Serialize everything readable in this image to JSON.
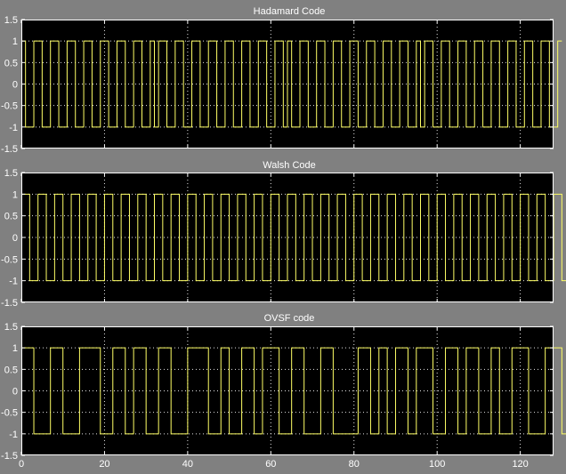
{
  "colors": {
    "figure_bg": "#808080",
    "axes_bg": "#000000",
    "signal": "#ffff66",
    "text": "#ffffff"
  },
  "chart_data": [
    {
      "type": "line",
      "title": "Hadamard Code",
      "xlim": [
        0,
        128
      ],
      "ylim": [
        -1.5,
        1.5
      ],
      "grid": true,
      "xticks": [
        0,
        20,
        40,
        60,
        80,
        100,
        120
      ],
      "xtick_labels_visible": false,
      "yticks": [
        -1.5,
        -1,
        -0.5,
        0,
        0.5,
        1,
        1.5
      ],
      "ytick_labels": [
        "-1.5",
        "-1",
        "-0.5",
        "0",
        "0.5",
        "1",
        "1.5"
      ],
      "series": [
        {
          "style": "step",
          "values": [
            1,
            -1,
            -1,
            1,
            1,
            -1,
            -1,
            1,
            1,
            -1,
            -1,
            1,
            1,
            -1,
            -1,
            1,
            1,
            -1,
            -1,
            1,
            1,
            -1,
            -1,
            1,
            1,
            -1,
            -1,
            1,
            1,
            -1,
            -1,
            1,
            -1,
            1,
            1,
            -1,
            -1,
            1,
            1,
            -1,
            -1,
            1,
            1,
            -1,
            -1,
            1,
            1,
            -1,
            -1,
            1,
            1,
            -1,
            -1,
            1,
            1,
            -1,
            -1,
            1,
            1,
            -1,
            -1,
            1,
            1,
            -1,
            1,
            -1,
            -1,
            1,
            1,
            -1,
            -1,
            1,
            1,
            -1,
            -1,
            1,
            1,
            -1,
            -1,
            1,
            1,
            -1,
            -1,
            1,
            1,
            -1,
            -1,
            1,
            1,
            -1,
            -1,
            1,
            1,
            -1,
            -1,
            1,
            -1,
            1,
            1,
            -1,
            -1,
            1,
            1,
            -1,
            -1,
            1,
            1,
            -1,
            -1,
            1,
            1,
            -1,
            -1,
            1,
            1,
            -1,
            -1,
            1,
            1,
            -1,
            -1,
            1,
            1,
            -1,
            -1,
            1,
            1,
            -1,
            -1,
            1
          ]
        }
      ]
    },
    {
      "type": "line",
      "title": "Walsh Code",
      "xlim": [
        0,
        128
      ],
      "ylim": [
        -1.5,
        1.5
      ],
      "grid": true,
      "xticks": [
        0,
        20,
        40,
        60,
        80,
        100,
        120
      ],
      "xtick_labels_visible": false,
      "yticks": [
        -1.5,
        -1,
        -0.5,
        0,
        0.5,
        1,
        1.5
      ],
      "ytick_labels": [
        "-1.5",
        "-1",
        "-0.5",
        "0",
        "0.5",
        "1",
        "1.5"
      ],
      "series": [
        {
          "style": "step",
          "values": [
            1,
            1,
            -1,
            -1,
            1,
            1,
            -1,
            -1,
            1,
            1,
            -1,
            -1,
            1,
            1,
            -1,
            -1,
            1,
            1,
            -1,
            -1,
            1,
            1,
            -1,
            -1,
            1,
            1,
            -1,
            -1,
            1,
            1,
            -1,
            -1,
            1,
            1,
            -1,
            -1,
            1,
            1,
            -1,
            -1,
            1,
            1,
            -1,
            -1,
            1,
            1,
            -1,
            -1,
            1,
            1,
            -1,
            -1,
            1,
            1,
            -1,
            -1,
            1,
            1,
            -1,
            -1,
            1,
            1,
            -1,
            -1,
            1,
            1,
            -1,
            -1,
            1,
            1,
            -1,
            -1,
            1,
            1,
            -1,
            -1,
            1,
            1,
            -1,
            -1,
            1,
            1,
            -1,
            -1,
            1,
            1,
            -1,
            -1,
            1,
            1,
            -1,
            -1,
            1,
            1,
            -1,
            -1,
            1,
            1,
            -1,
            -1,
            1,
            1,
            -1,
            -1,
            1,
            1,
            -1,
            -1,
            1,
            1,
            -1,
            -1,
            1,
            1,
            -1,
            -1,
            1,
            1,
            -1,
            -1,
            1,
            1,
            -1,
            -1,
            1,
            1,
            -1,
            -1,
            1,
            1,
            -1,
            -1
          ]
        }
      ]
    },
    {
      "type": "line",
      "title": "OVSF code",
      "xlim": [
        0,
        128
      ],
      "ylim": [
        -1.5,
        1.5
      ],
      "grid": true,
      "xticks": [
        0,
        20,
        40,
        60,
        80,
        100,
        120
      ],
      "xtick_labels": [
        "0",
        "20",
        "40",
        "60",
        "80",
        "100",
        "120"
      ],
      "yticks": [
        -1.5,
        -1,
        -0.5,
        0,
        0.5,
        1,
        1.5
      ],
      "ytick_labels": [
        "-1.5",
        "-1",
        "-0.5",
        "0",
        "0.5",
        "1",
        "1.5"
      ],
      "series": [
        {
          "style": "step",
          "values": [
            1,
            1,
            1,
            -1,
            -1,
            -1,
            -1,
            1,
            1,
            1,
            -1,
            -1,
            -1,
            -1,
            1,
            1,
            1,
            1,
            1,
            -1,
            -1,
            -1,
            1,
            1,
            1,
            -1,
            -1,
            1,
            1,
            1,
            -1,
            -1,
            -1,
            1,
            1,
            1,
            -1,
            -1,
            -1,
            -1,
            1,
            1,
            1,
            1,
            1,
            -1,
            -1,
            -1,
            1,
            1,
            -1,
            -1,
            -1,
            1,
            1,
            1,
            -1,
            -1,
            1,
            1,
            1,
            1,
            -1,
            -1,
            -1,
            1,
            1,
            1,
            -1,
            -1,
            -1,
            -1,
            1,
            1,
            1,
            -1,
            -1,
            -1,
            -1,
            -1,
            -1,
            1,
            1,
            1,
            -1,
            -1,
            1,
            1,
            -1,
            -1,
            1,
            1,
            1,
            -1,
            -1,
            1,
            1,
            1,
            1,
            -1,
            -1,
            -1,
            1,
            1,
            1,
            -1,
            -1,
            1,
            1,
            1,
            -1,
            -1,
            -1,
            1,
            1,
            -1,
            -1,
            -1,
            1,
            1,
            1,
            1,
            -1,
            -1,
            -1,
            -1,
            1,
            1,
            1,
            1,
            -1
          ]
        }
      ]
    }
  ]
}
